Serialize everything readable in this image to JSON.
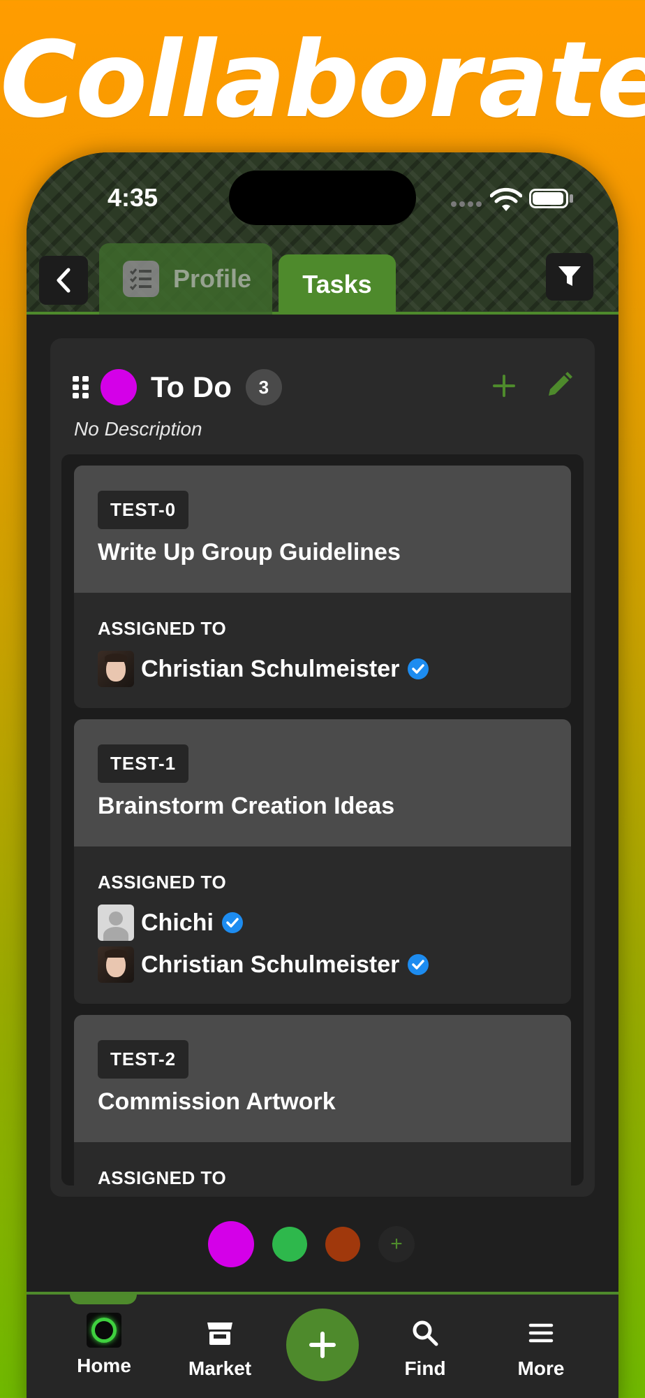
{
  "headline": "Collaborate",
  "status_bar": {
    "time": "4:35"
  },
  "header": {
    "tabs": [
      {
        "label": "Profile",
        "active": false
      },
      {
        "label": "Tasks",
        "active": true
      }
    ]
  },
  "column": {
    "title": "To Do",
    "count": "3",
    "description": "No Description",
    "color": "#d400e8"
  },
  "cards": [
    {
      "tag": "TEST-0",
      "title": "Write Up Group Guidelines",
      "assigned_label": "ASSIGNED TO",
      "assignees": [
        {
          "name": "Christian Schulmeister",
          "avatar": "photo",
          "verified": true
        }
      ]
    },
    {
      "tag": "TEST-1",
      "title": "Brainstorm Creation Ideas",
      "assigned_label": "ASSIGNED TO",
      "assignees": [
        {
          "name": "Chichi",
          "avatar": "blank",
          "verified": true
        },
        {
          "name": "Christian Schulmeister",
          "avatar": "photo",
          "verified": true
        }
      ]
    },
    {
      "tag": "TEST-2",
      "title": "Commission Artwork",
      "assigned_label": "ASSIGNED TO",
      "assignees": []
    }
  ],
  "column_switcher": {
    "colors": [
      "#d400e8",
      "#2eb84c",
      "#a0380c"
    ],
    "add_label": "+"
  },
  "nav": {
    "home": "Home",
    "market": "Market",
    "fab": "+",
    "find": "Find",
    "more": "More"
  },
  "theme": {
    "accent": "#4e8a2c",
    "background": "#1f1f1f"
  }
}
